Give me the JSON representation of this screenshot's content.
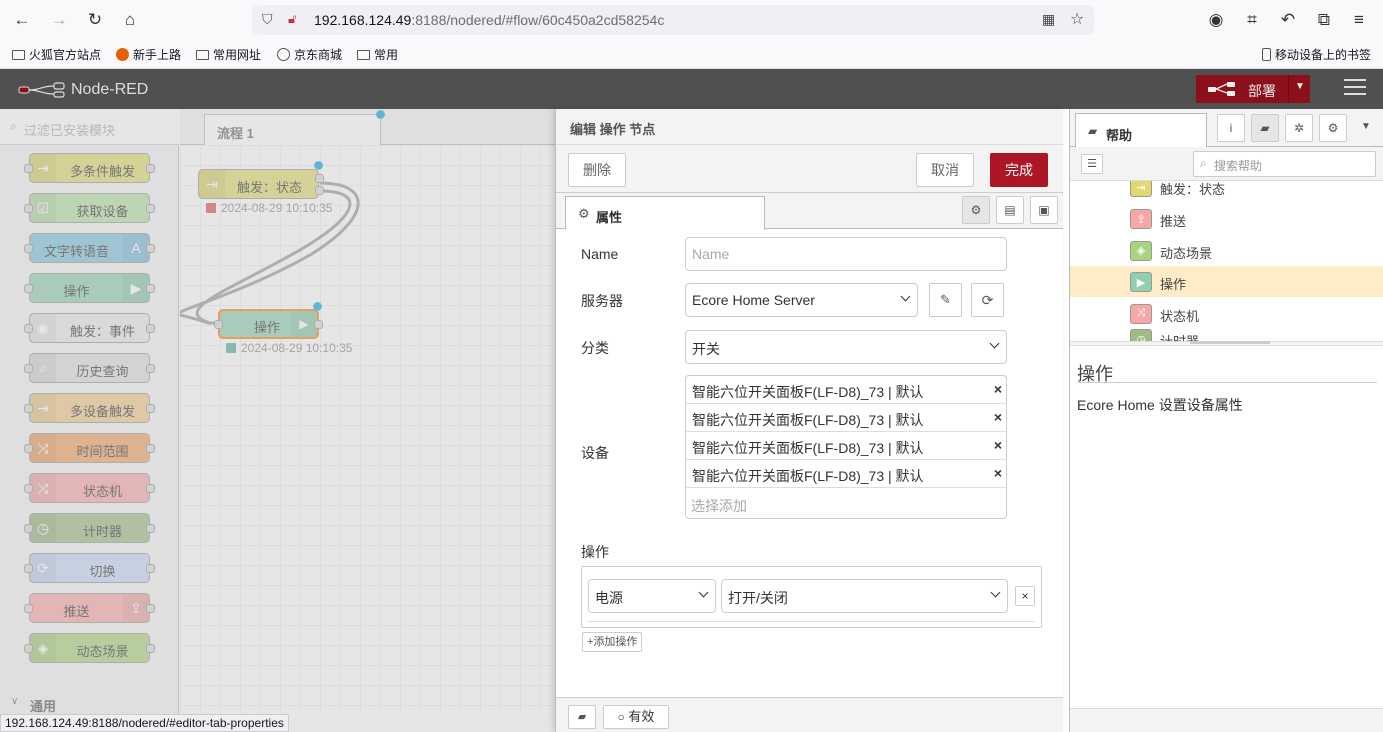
{
  "browser": {
    "url_host": "192.168.124.49",
    "url_rest": ":8188/nodered/#flow/60c450a2cd58254c",
    "bookmarks": [
      "火狐官方站点",
      "新手上路",
      "常用网址",
      "京东商城",
      "常用"
    ],
    "mobile_bookmarks": "移动设备上的书签",
    "status_url": "192.168.124.49:8188/nodered/#editor-tab-properties"
  },
  "header": {
    "title": "Node-RED",
    "deploy_label": "部署"
  },
  "palette": {
    "search_placeholder": "过滤已安装模块",
    "nodes": [
      {
        "label": "多条件触发",
        "color": "#e2d96e",
        "icon": "sign-in-icon",
        "glyph": "⇥",
        "icon_side": "left"
      },
      {
        "label": "获取设备",
        "color": "#b7e1a5",
        "icon": "check-square-icon",
        "glyph": "☑",
        "icon_side": "left"
      },
      {
        "label": "文字转语音",
        "color": "#7ec3df",
        "icon": "speech-icon",
        "glyph": "A",
        "icon_side": "right"
      },
      {
        "label": "操作",
        "color": "#8fd0ae",
        "icon": "play-circle-icon",
        "glyph": "▶",
        "icon_side": "right"
      },
      {
        "label": "触发：事件",
        "color": "#e8e8e8",
        "icon": "broadcast-icon",
        "glyph": "◉",
        "icon_side": "left"
      },
      {
        "label": "历史查询",
        "color": "#dcdcdc",
        "icon": "search-icon",
        "glyph": "⌕",
        "icon_side": "left"
      },
      {
        "label": "多设备触发",
        "color": "#f3c98b",
        "icon": "sign-in-icon",
        "glyph": "⇥",
        "icon_side": "left"
      },
      {
        "label": "时间范围",
        "color": "#f2a163",
        "icon": "branch-icon",
        "glyph": "⤨",
        "icon_side": "left"
      },
      {
        "label": "状态机",
        "color": "#f7a8a6",
        "icon": "branch-icon",
        "glyph": "⤨",
        "icon_side": "left"
      },
      {
        "label": "计时器",
        "color": "#9dbb82",
        "icon": "timer-icon",
        "glyph": "◷",
        "icon_side": "left"
      },
      {
        "label": "切换",
        "color": "#c4d7f5",
        "icon": "refresh-icon",
        "glyph": "⟳",
        "icon_side": "left"
      },
      {
        "label": "推送",
        "color": "#f7a8a6",
        "icon": "share-icon",
        "glyph": "⇪",
        "icon_side": "right"
      },
      {
        "label": "动态场景",
        "color": "#a8d47c",
        "icon": "layers-icon",
        "glyph": "◈",
        "icon_side": "left"
      }
    ],
    "category": "通用"
  },
  "workspace": {
    "flow_tab": "流程 1",
    "nodes": [
      {
        "label": "触发：状态",
        "status": "2024-08-29 10:10:35",
        "status_color": "#d9534f"
      },
      {
        "label": "操作",
        "status": "2024-08-29 10:10:35",
        "status_color": "#5a9"
      }
    ]
  },
  "editor": {
    "title": "编辑 操作 节点",
    "delete_label": "删除",
    "cancel_label": "取消",
    "done_label": "完成",
    "properties_tab": "属性",
    "name_label": "Name",
    "name_placeholder": "Name",
    "server_label": "服务器",
    "server_value": "Ecore Home Server",
    "category_label": "分类",
    "category_value": "开关",
    "device_label": "设备",
    "devices": [
      "智能六位开关面板F(LF-D8)_73 | 默认",
      "智能六位开关面板F(LF-D8)_73 | 默认",
      "智能六位开关面板F(LF-D8)_73 | 默认",
      "智能六位开关面板F(LF-D8)_73 | 默认"
    ],
    "device_add_placeholder": "选择添加",
    "operation_label": "操作",
    "op_select_1": "电源",
    "op_select_2": "打开/关闭",
    "add_op_label": "添加操作",
    "enabled_label": "有效"
  },
  "sidebar": {
    "help_tab": "帮助",
    "search_placeholder": "搜索帮助",
    "tree_items": [
      {
        "label": "推送",
        "color": "#f7a8a6",
        "glyph": "⇪"
      },
      {
        "label": "动态场景",
        "color": "#a8d47c",
        "glyph": "◈"
      },
      {
        "label": "操作",
        "color": "#8fd0ae",
        "glyph": "▶",
        "selected": true
      },
      {
        "label": "状态机",
        "color": "#f7a8a6",
        "glyph": "⤨"
      }
    ],
    "partial_top": "触发：状态",
    "partial_bottom": "计时器",
    "help_title": "操作",
    "help_desc": "Ecore Home 设置设备属性"
  }
}
